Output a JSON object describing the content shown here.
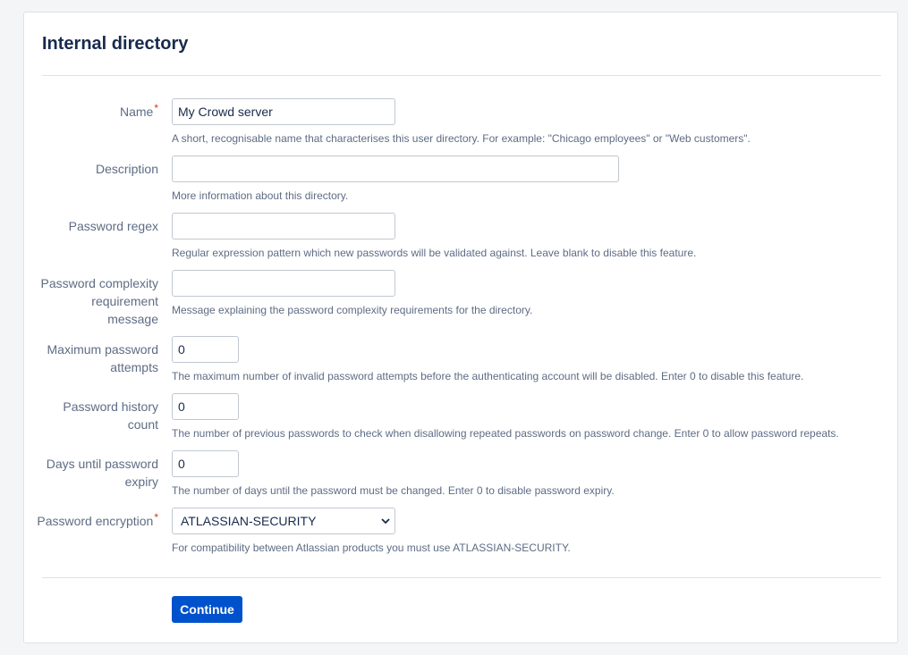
{
  "page": {
    "title": "Internal directory"
  },
  "form": {
    "name": {
      "label": "Name",
      "required_mark": "*",
      "value": "My Crowd server",
      "help": "A short, recognisable name that characterises this user directory. For example: \"Chicago employees\" or \"Web customers\"."
    },
    "description": {
      "label": "Description",
      "value": "",
      "help": "More information about this directory."
    },
    "password_regex": {
      "label": "Password regex",
      "value": "",
      "help": "Regular expression pattern which new passwords will be validated against. Leave blank to disable this feature."
    },
    "password_complexity": {
      "label_line1": "Password complexity",
      "label_line2": "requirement",
      "label_line3": "message",
      "value": "",
      "help": "Message explaining the password complexity requirements for the directory."
    },
    "max_attempts": {
      "label_line1": "Maximum password",
      "label_line2": "attempts",
      "value": "0",
      "help": "The maximum number of invalid password attempts before the authenticating account will be disabled. Enter 0 to disable this feature."
    },
    "history_count": {
      "label_line1": "Password history",
      "label_line2": "count",
      "value": "0",
      "help": "The number of previous passwords to check when disallowing repeated passwords on password change. Enter 0 to allow password repeats."
    },
    "expiry_days": {
      "label_line1": "Days until password",
      "label_line2": "expiry",
      "value": "0",
      "help": "The number of days until the password must be changed. Enter 0 to disable password expiry."
    },
    "encryption": {
      "label": "Password encryption",
      "required_mark": "*",
      "selected": "ATLASSIAN-SECURITY",
      "help": "For compatibility between Atlassian products you must use ATLASSIAN-SECURITY."
    }
  },
  "actions": {
    "continue_label": "Continue"
  },
  "icons": {
    "select_arrow": "chevron-down-icon"
  },
  "colors": {
    "primary": "#0052cc",
    "required": "#de350b",
    "text": "#172b4d",
    "muted": "#5e6c84"
  }
}
